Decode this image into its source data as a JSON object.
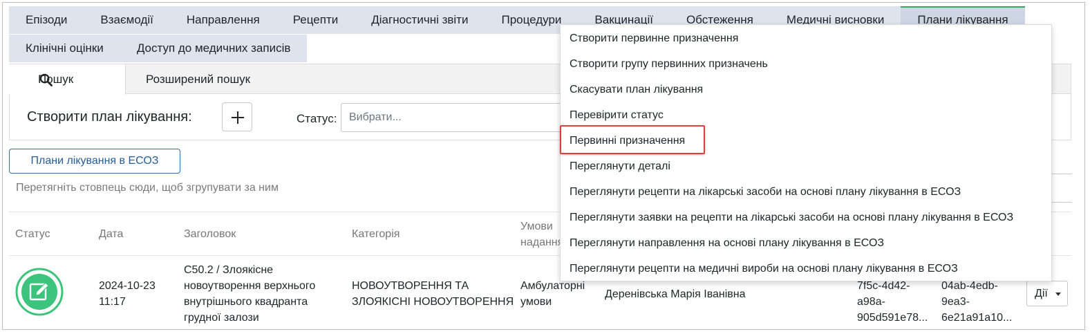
{
  "module_tabs": {
    "row1": [
      "Епізоди",
      "Взаємодії",
      "Направлення",
      "Рецепти",
      "Діагностичні звіти",
      "Процедури",
      "Вакцинації",
      "Обстеження",
      "Медичні висновки",
      "Плани лікування"
    ],
    "row2": [
      "Клінічні оцінки",
      "Доступ до медичних записів"
    ],
    "active": "Плани лікування"
  },
  "search": {
    "tabs": [
      "Пошук",
      "Розширений пошук"
    ],
    "create_label": "Створити план лікування:",
    "status_label": "Статус:",
    "status_placeholder": "Вибрати..."
  },
  "eco_button": "Плани лікування в ЕСОЗ",
  "group_hint": "Перетягніть стовпець сюди, щоб згрупувати за ним",
  "table": {
    "headers": {
      "status": "Статус",
      "date": "Дата",
      "title": "Заголовок",
      "category": "Категорія",
      "terms_line1": "Умови",
      "terms_line2": "надання"
    },
    "row": {
      "date": "2024-10-23",
      "time": "11:17",
      "title_lines": [
        "C50.2 / Злоякісне",
        "новоутворення верхнього",
        "внутрішнього квадранта",
        "грудної залози"
      ],
      "category_lines": [
        "НОВОУТВОРЕННЯ ТА",
        "ЗЛОЯКІСНІ НОВОУТВОРЕННЯ"
      ],
      "terms_lines": [
        "Амбулаторні",
        "умови"
      ],
      "doctor": "Деренівська Марія Іванівна",
      "id1_lines": [
        "7f5c-4d42-",
        "a98a-",
        "905d591e78..."
      ],
      "id2_lines": [
        "04ab-4edb-",
        "9ea3-",
        "6e21a91a10..."
      ],
      "actions_label": "Дії"
    }
  },
  "menu": {
    "items": [
      "Створити первинне призначення",
      "Створити групу первинних призначень",
      "Скасувати план лікування",
      "Перевірити статус",
      "Первинні призначення",
      "Переглянути деталі",
      "Переглянути рецепти на лікарські засоби на основі плану лікування в ЕСОЗ",
      "Переглянути заявки на рецепти на лікарські засоби на основі плану лікування в ЕСОЗ",
      "Переглянути направлення на основі плану лікування в ЕСОЗ",
      "Переглянути рецепти на медичні вироби на основі плану лікування в ЕСОЗ"
    ],
    "highlighted": "Первинні призначення"
  },
  "colors": {
    "tab_bg": "#dde4ee",
    "active_accent": "#2eac5e",
    "status_icon": "#3cc47c",
    "link_blue": "#245d9a",
    "highlight_red": "#d9413f"
  }
}
